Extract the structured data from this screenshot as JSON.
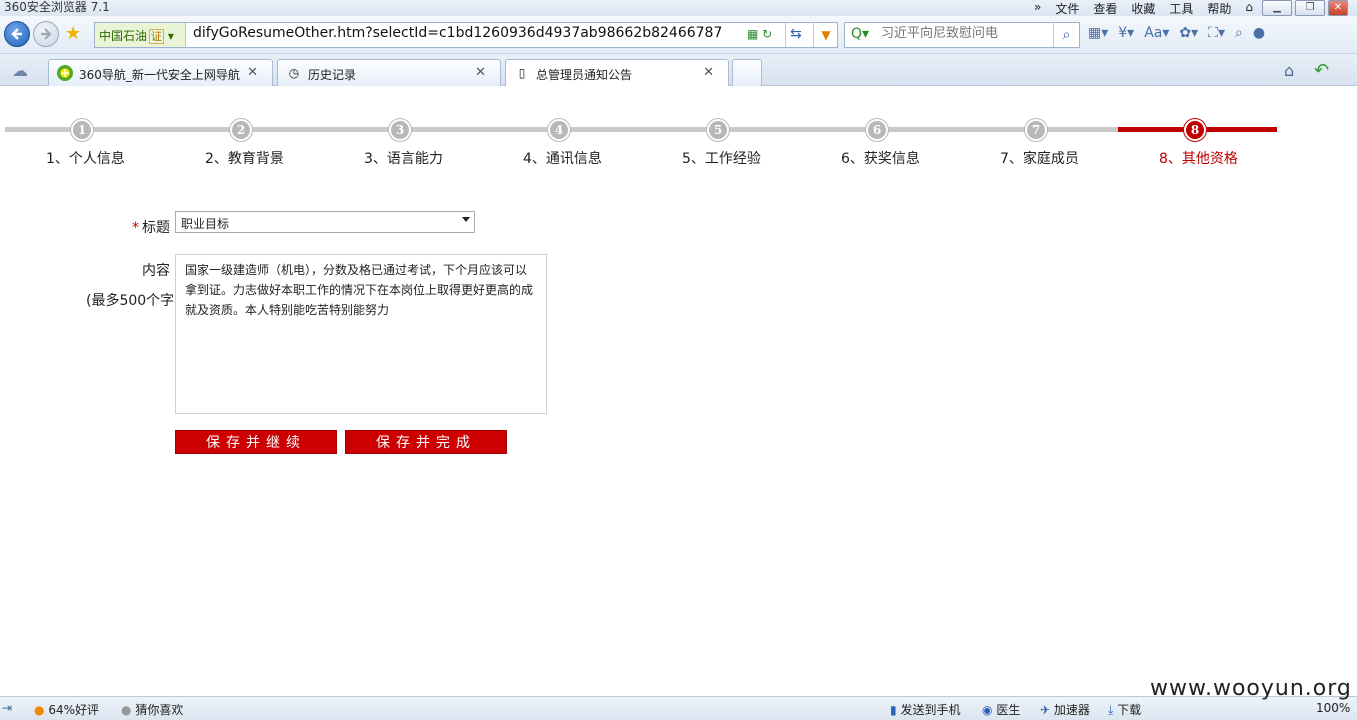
{
  "window": {
    "title": "360安全浏览器 7.1",
    "menu": [
      "文件",
      "查看",
      "收藏",
      "工具",
      "帮助"
    ]
  },
  "toolbar": {
    "cert_label": "中国石油",
    "cert_badge": "证",
    "address": "difyGoResumeOther.htm?selectId=c1bd1260936d4937ab98662b82466787",
    "search_placeholder": "习近平向尼致慰问电"
  },
  "tabs": [
    {
      "label": "360导航_新一代安全上网导航",
      "active": false
    },
    {
      "label": "历史记录",
      "active": false
    },
    {
      "label": "总管理员通知公告",
      "active": true
    }
  ],
  "steps": [
    {
      "num": "1",
      "label": "1、个人信息"
    },
    {
      "num": "2",
      "label": "2、教育背景"
    },
    {
      "num": "3",
      "label": "3、语言能力"
    },
    {
      "num": "4",
      "label": "4、通讯信息"
    },
    {
      "num": "5",
      "label": "5、工作经验"
    },
    {
      "num": "6",
      "label": "6、获奖信息"
    },
    {
      "num": "7",
      "label": "7、家庭成员"
    },
    {
      "num": "8",
      "label": "8、其他资格"
    }
  ],
  "current_step": 8,
  "form": {
    "required_mark": "*",
    "title_label": "标题",
    "title_value": "职业目标",
    "content_label": "内容",
    "content_hint": "(最多500个字)",
    "content_value": "国家一级建造师（机电），分数及格已通过考试，下个月应该可以拿到证。力志做好本职工作的情况下在本岗位上取得更好更高的成就及资质。本人特别能吃苦特别能努力",
    "save_continue_label": "保存并继续",
    "save_finish_label": "保存并完成"
  },
  "statusbar": {
    "rating": "64%好评",
    "guess": "猜你喜欢",
    "send_phone": "发送到手机",
    "doctor": "医生",
    "accelerator": "加速器",
    "download": "下载",
    "zoom": "100%"
  },
  "watermark": "www.wooyun.org"
}
